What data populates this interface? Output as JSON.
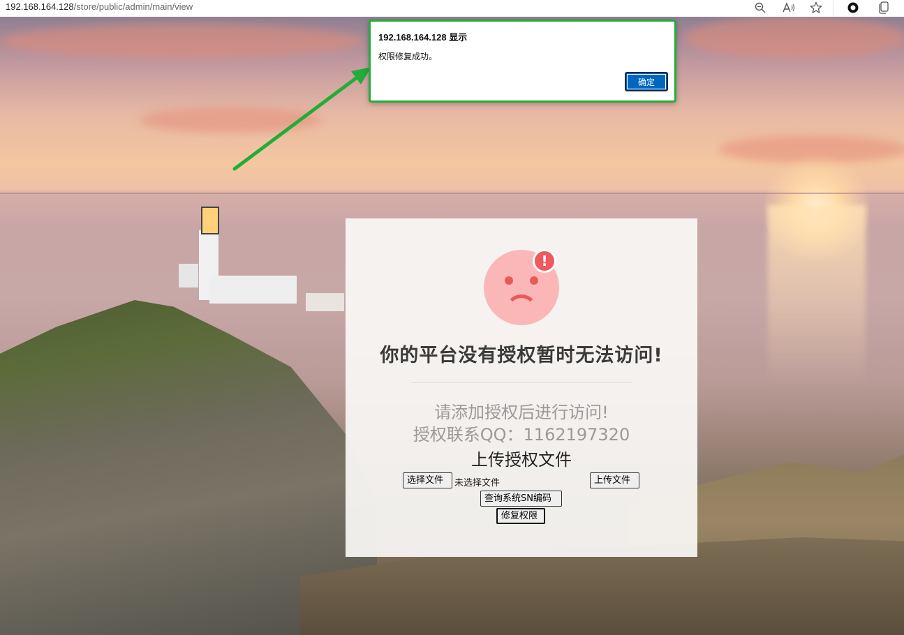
{
  "browser": {
    "url_host": "192.168.164.128",
    "url_path": "/store/public/admin/main/view"
  },
  "dialog": {
    "title": "192.168.164.128 显示",
    "message": "权限修复成功。",
    "ok_label": "确定",
    "highlight_color": "#22ac3a"
  },
  "panel": {
    "title": "你的平台没有授权暂时无法访问!",
    "subtitle1": "请添加授权后进行访问!",
    "subtitle2": "授权联系QQ：1162197320",
    "upload_heading": "上传授权文件",
    "choose_file_label": "选择文件",
    "no_file_text": "未选择文件",
    "upload_label": "上传文件",
    "query_sn_label": "查询系统SN编码",
    "repair_label": "修复权限",
    "badge_symbol": "!"
  },
  "colors": {
    "face": "#fbb7b7",
    "face_features": "#e85a5a",
    "badge": "#ef5a5f",
    "ok_button": "#0067c0"
  }
}
